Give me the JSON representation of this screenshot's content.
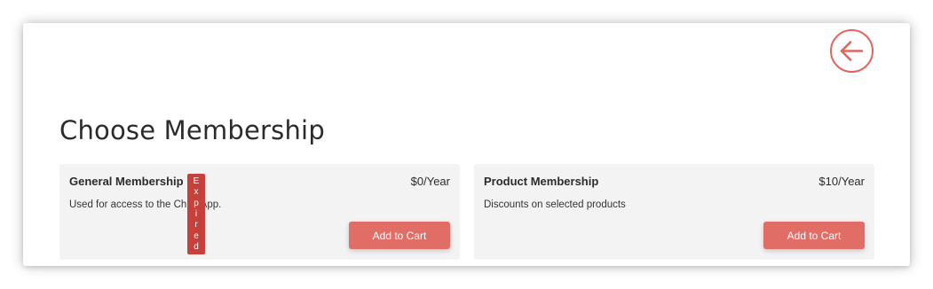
{
  "page": {
    "title": "Choose Membership",
    "accent_color": "#e0655f",
    "back_icon": "arrow-left-circle-icon"
  },
  "memberships": [
    {
      "name": "General Membership",
      "price": "$0/Year",
      "description": "Used for access to the Ch     In App.",
      "button_label": "Add to Cart",
      "badge": "Expired"
    },
    {
      "name": "Product Membership",
      "price": "$10/Year",
      "description": "Discounts on selected products",
      "button_label": "Add to Cart"
    }
  ],
  "colors": {
    "button": "#e06d66",
    "badge": "#c7413c",
    "card_bg": "#f3f3f3",
    "text": "#2b2b2b"
  }
}
